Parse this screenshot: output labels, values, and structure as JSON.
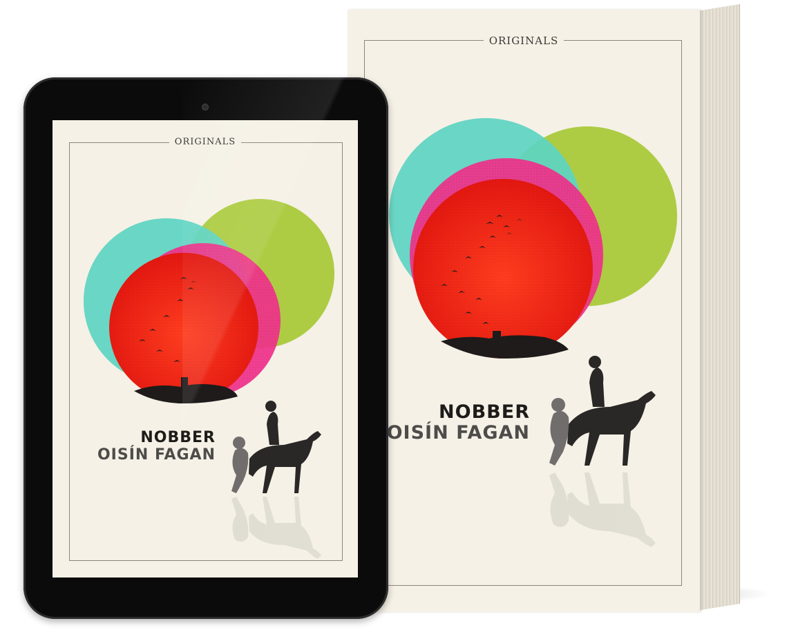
{
  "book": {
    "brand": "ORIGINALS",
    "title": "NOBBER",
    "author": "OISÍN FAGAN"
  },
  "tablet_cover": {
    "brand": "ORIGINALS",
    "title": "NOBBER",
    "author": "OISÍN FAGAN"
  },
  "colors": {
    "cover_background": "#f5f1e6",
    "green_circle": "#a9c93a",
    "teal_circle": "#5fd4c2",
    "pink_circle": "#f0318b",
    "red_sun": "#f0201b",
    "silhouette": "#2a2727",
    "tablet_body": "#0b0b0b"
  },
  "icons": {
    "publisher_mark": "originals-logo-mark",
    "horse_rider": "horse-and-rider-silhouette",
    "bird_flock": "bird-flock-silhouette"
  }
}
